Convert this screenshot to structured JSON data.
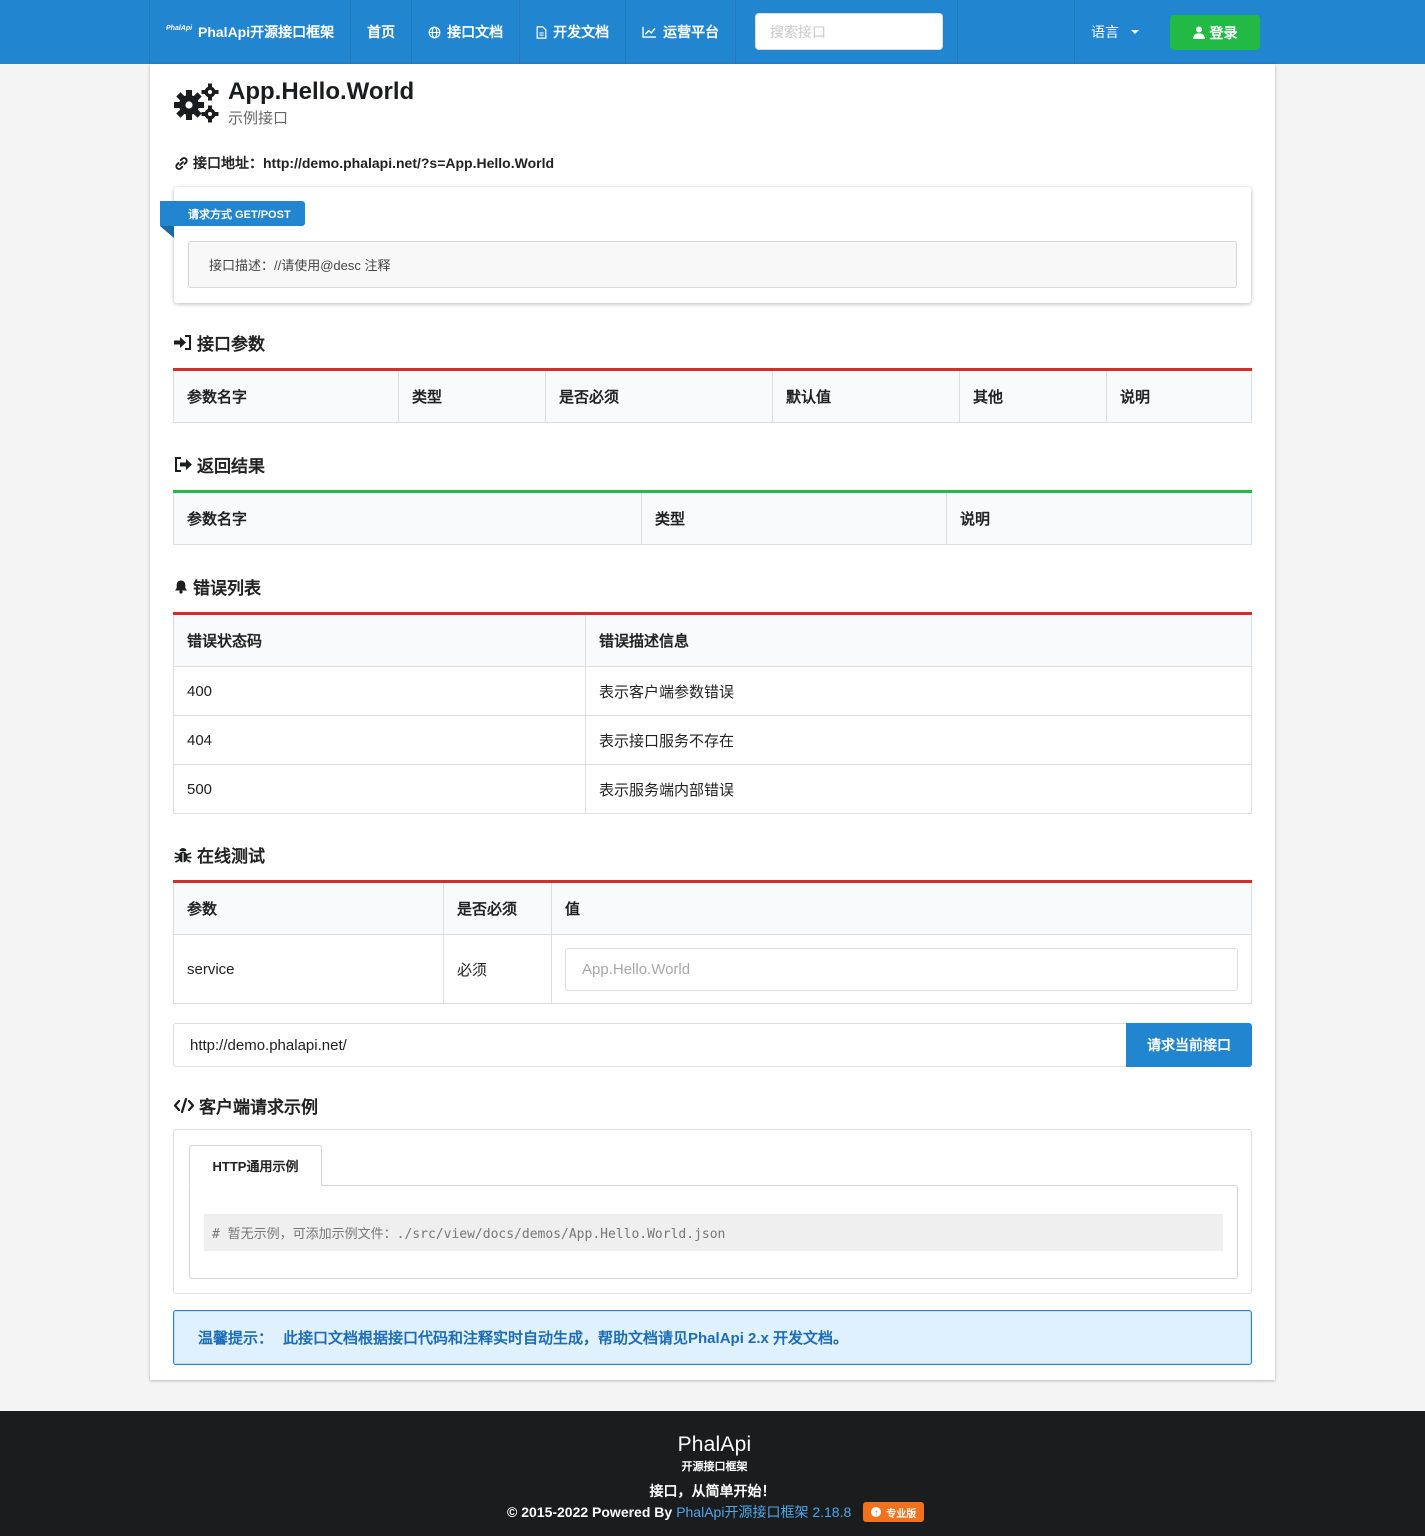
{
  "nav": {
    "brand": "PhalApi开源接口框架",
    "brand_logo_text": "PhalApi",
    "items": [
      {
        "label": "首页"
      },
      {
        "label": "接口文档",
        "icon": "globe-icon"
      },
      {
        "label": "开发文档",
        "icon": "file-icon"
      },
      {
        "label": "运营平台",
        "icon": "chart-line-icon"
      }
    ],
    "search_placeholder": "搜索接口",
    "language": "语言",
    "login": "登录"
  },
  "api": {
    "name": "App.Hello.World",
    "subtitle": "示例接口",
    "url_label": "接口地址：",
    "url": "http://demo.phalapi.net/?s=App.Hello.World",
    "method": "请求方式 GET/POST",
    "desc": "接口描述：//请使用@desc 注释"
  },
  "params_section": {
    "title": "接口参数",
    "columns": [
      "参数名字",
      "类型",
      "是否必须",
      "默认值",
      "其他",
      "说明"
    ]
  },
  "return_section": {
    "title": "返回结果",
    "columns": [
      "参数名字",
      "类型",
      "说明"
    ]
  },
  "error_section": {
    "title": "错误列表",
    "columns": [
      "错误状态码",
      "错误描述信息"
    ],
    "rows": [
      [
        "400",
        "表示客户端参数错误"
      ],
      [
        "404",
        "表示接口服务不存在"
      ],
      [
        "500",
        "表示服务端内部错误"
      ]
    ]
  },
  "test_section": {
    "title": "在线测试",
    "columns": [
      "参数",
      "是否必须",
      "值"
    ],
    "rows": [
      {
        "name": "service",
        "required": "必须",
        "placeholder": "App.Hello.World"
      }
    ],
    "base_url": "http://demo.phalapi.net/",
    "submit": "请求当前接口"
  },
  "client_section": {
    "title": "客户端请求示例",
    "tab": "HTTP通用示例",
    "code": "# 暂无示例，可添加示例文件：./src/view/docs/demos/App.Hello.World.json"
  },
  "tip": {
    "label": "温馨提示：",
    "text": "此接口文档根据接口代码和注释实时自动生成，帮助文档请见PhalApi 2.x 开发文档。"
  },
  "footer": {
    "logo_word": "PhalApi",
    "logo_cn": "开源接口框架",
    "slogan": "接口，从简单开始！",
    "copyright": "© 2015-2022 Powered By",
    "link": "PhalApi开源接口框架 2.18.8",
    "badge": "专业版"
  },
  "colors": {
    "primary": "#2185d0",
    "success": "#21ba45",
    "danger": "#db2828",
    "warning": "#f2711c",
    "footer_bg": "#1b1c1d"
  }
}
